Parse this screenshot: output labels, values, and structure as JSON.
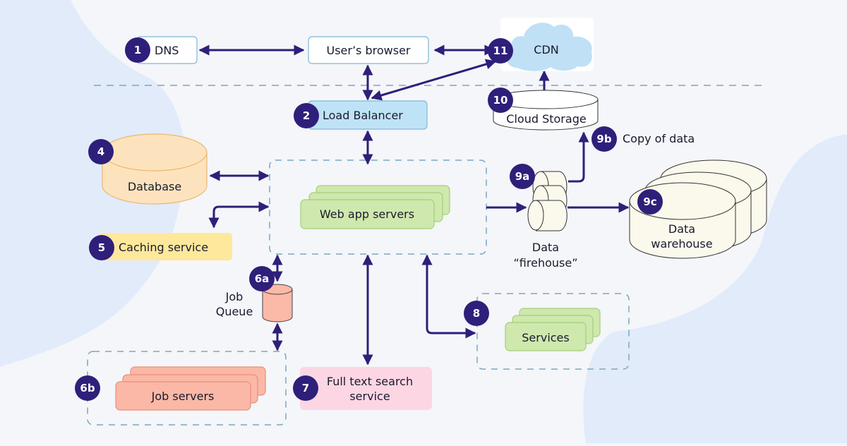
{
  "colors": {
    "background": "#f4f6f9",
    "blob": "#e2ebfa",
    "arrow": "#2e1f7a",
    "badge": "#2e1f7a",
    "dashed": "#7aa6c2",
    "dns_fill": "#ffffff",
    "browser_fill": "#ffffff",
    "box_border": "#7fb8d8",
    "load_balancer": "#bfe3f6",
    "cdn": "#bfe0f5",
    "database": "#fde3bd",
    "database_stroke": "#eab770",
    "caching": "#fde89c",
    "web_servers": "#cfe8ad",
    "web_servers_stroke": "#a4cf7a",
    "job_queue": "#fbb9a8",
    "job_servers": "#fbb8a6",
    "job_servers_stroke": "#eb8e78",
    "search": "#fdd6e3",
    "cream": "#fbf8ec",
    "text": "#1a1a2e"
  },
  "nodes": {
    "dns": {
      "badge": "1",
      "label": "DNS"
    },
    "browser": {
      "label": "User’s browser"
    },
    "cdn": {
      "badge": "11",
      "label": "CDN"
    },
    "load_balancer": {
      "badge": "2",
      "label": "Load Balancer"
    },
    "cloud_storage": {
      "badge": "10",
      "label": "Cloud Storage"
    },
    "copy_of_data": {
      "badge": "9b",
      "label": "Copy of data"
    },
    "database": {
      "badge": "4",
      "label": "Database"
    },
    "web_app_servers": {
      "label": "Web app servers"
    },
    "caching": {
      "badge": "5",
      "label": "Caching service"
    },
    "firehose": {
      "badge": "9a",
      "label_line1": "Data",
      "label_line2": "“firehouse”"
    },
    "warehouse": {
      "badge": "9c",
      "label_line1": "Data",
      "label_line2": "warehouse"
    },
    "job_queue": {
      "badge": "6a",
      "label_line1": "Job",
      "label_line2": "Queue"
    },
    "job_servers": {
      "badge": "6b",
      "label": "Job servers"
    },
    "search": {
      "badge": "7",
      "label_line1": "Full text search",
      "label_line2": "service"
    },
    "services": {
      "badge": "8",
      "label": "Services"
    }
  }
}
